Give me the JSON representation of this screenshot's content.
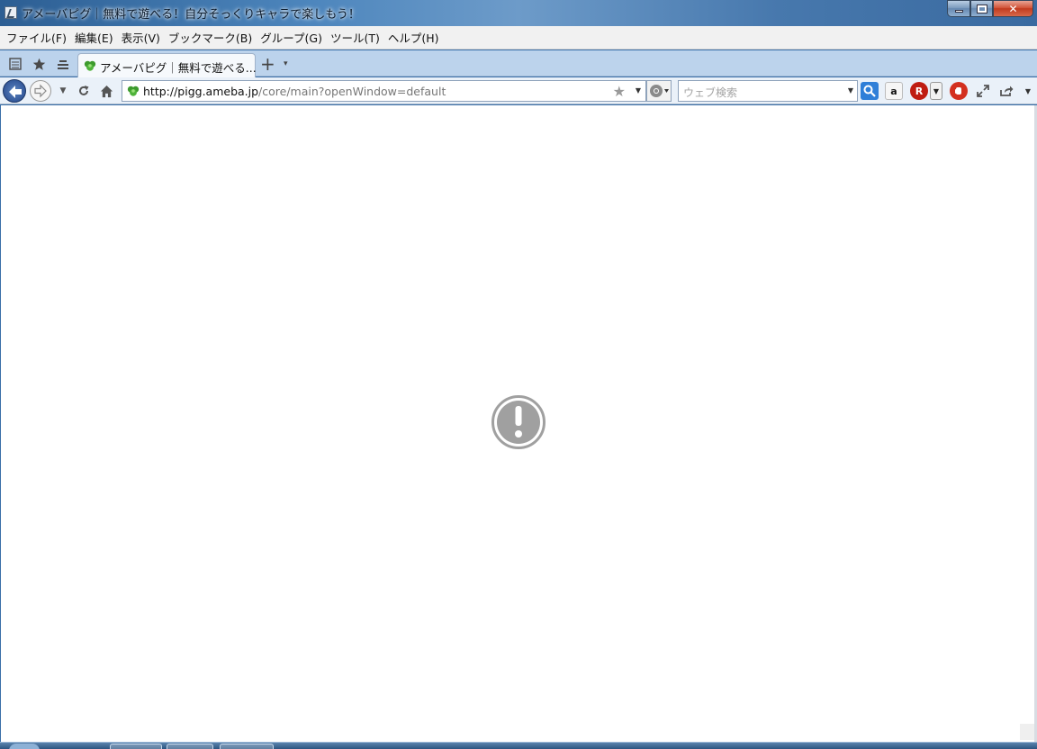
{
  "window": {
    "title": "アメーバピグ｜無料で遊べる！自分そっくりキャラで楽しもう！",
    "buttons": {
      "minimize_icon": "minimize-icon",
      "maximize_icon": "restore-icon",
      "close_icon": "close-icon",
      "close_label": "✕"
    }
  },
  "menubar": {
    "items": [
      {
        "label": "ファイル(F)"
      },
      {
        "label": "編集(E)"
      },
      {
        "label": "表示(V)"
      },
      {
        "label": "ブックマーク(B)"
      },
      {
        "label": "グループ(G)"
      },
      {
        "label": "ツール(T)"
      },
      {
        "label": "ヘルプ(H)"
      }
    ]
  },
  "tabbar": {
    "tab_label": "アメーバピグ｜無料で遊べる...",
    "add_tab": "+",
    "tab_menu": "▾"
  },
  "navbar": {
    "url_host": "http://pigg.ameba.jp",
    "url_path": "/core/main?openWindow=default",
    "search_placeholder": "ウェブ検索",
    "amazon_label": "a",
    "rakuten_label": "R"
  },
  "content": {
    "status_icon": "alert-exclamation-icon"
  },
  "colors": {
    "titlebar": "#4d86bd",
    "tabbar": "#bcd3ec",
    "navbar": "#eaf1f9",
    "alert_icon": "#a0a0a0",
    "close_button": "#c13b1f"
  }
}
